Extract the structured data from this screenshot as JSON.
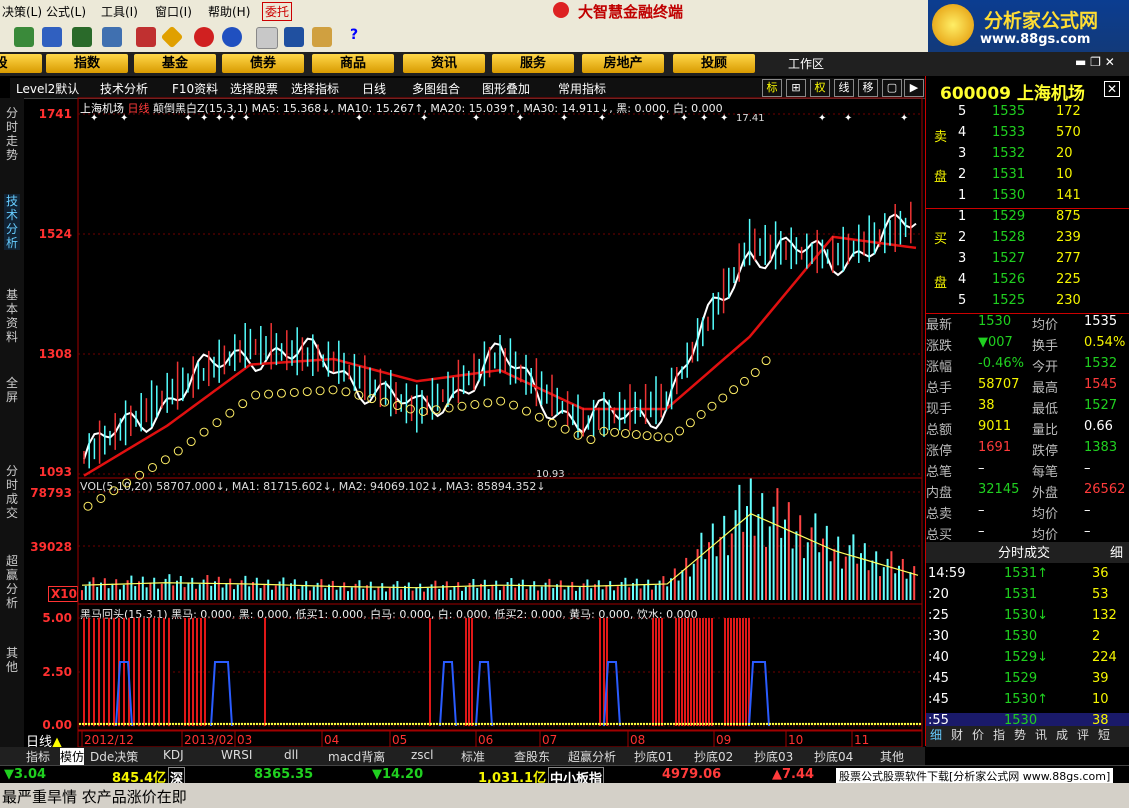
{
  "menu": {
    "items": [
      "决策(L)",
      "公式(L)",
      "工具(I)",
      "窗口(I)",
      "帮助(H)",
      "委托"
    ],
    "title": "大智慧金融终端"
  },
  "brand": {
    "name": "分析家公式网",
    "url": "www.88gs.com"
  },
  "market_buttons": [
    "股",
    "指数",
    "基金",
    "债券",
    "商品",
    "资讯",
    "服务",
    "房地产",
    "投顾"
  ],
  "workzone": "工作区",
  "chart_toolbar": {
    "items": [
      "Level2默认",
      "技术分析",
      "F10资料",
      "选择股票",
      "选择指标",
      "日线",
      "多图组合",
      "图形叠加",
      "常用指标"
    ],
    "right_buttons": [
      "标",
      "权",
      "线",
      "移"
    ]
  },
  "left_tabs": [
    "分时走势",
    "技术分析",
    "基本资料",
    "全屏",
    "分时成交",
    "超赢分析",
    "其他"
  ],
  "main_chart": {
    "stock_name": "上海机场",
    "period": "日线",
    "indicator_line": "颠倒黑白Z(15,3,1)  MA5: 15.368↓, MA10: 15.267↑, MA20: 15.039↑, MA30: 14.911↓, 黑: 0.000, 白: 0.000",
    "price_labels": [
      "1741",
      "1524",
      "1308",
      "1093"
    ],
    "high_note": "17.41",
    "low_note": "10.93"
  },
  "volume_chart": {
    "header": "VOL(5,10,20) 58707.000↓, MA1: 81715.602↓, MA2: 94069.102↓, MA3: 85894.352↓",
    "labels": [
      "78793",
      "39028",
      "X10"
    ]
  },
  "sub_chart": {
    "header": "黑马回头(15,3,1) 黑马: 0.000, 黑: 0.000, 低买1: 0.000, 白马: 0.000, 白: 0.000, 低买2: 0.000, 黄马: 0.000, 饮水: 0.000",
    "labels": [
      "5.00",
      "2.50",
      "0.00"
    ]
  },
  "x_axis": [
    "2012/12",
    "2013/02",
    "03",
    "04",
    "05",
    "06",
    "07",
    "08",
    "09",
    "10",
    "11"
  ],
  "timeframe_label": "日线",
  "chart_data": [
    {
      "type": "line",
      "title": "上海机场 日线",
      "x": [
        "2012/12",
        "2013/02",
        "03",
        "04",
        "05",
        "06",
        "07",
        "08",
        "09",
        "10",
        "11"
      ],
      "series": [
        {
          "name": "MA5",
          "values": [
            11.2,
            12.3,
            13.2,
            12.9,
            12.0,
            13.0,
            11.8,
            12.2,
            15.0,
            14.8,
            15.4
          ]
        },
        {
          "name": "MA20",
          "values": [
            10.9,
            11.8,
            12.9,
            13.0,
            12.6,
            12.8,
            12.1,
            12.1,
            13.4,
            15.2,
            15.0
          ]
        }
      ],
      "ylim": [
        10.93,
        17.41
      ]
    },
    {
      "type": "bar",
      "title": "VOL(5,10,20)",
      "categories": [
        "2012/12",
        "2013/02",
        "03",
        "04",
        "05",
        "06",
        "07",
        "08",
        "09",
        "10",
        "11"
      ],
      "values": [
        12000,
        14000,
        13000,
        11000,
        10000,
        12000,
        11000,
        13000,
        70000,
        40000,
        20000
      ],
      "ylim": [
        0,
        78793
      ]
    }
  ],
  "quote": {
    "code": "600009",
    "name": "上海机场",
    "sell_label": [
      "卖",
      "盘"
    ],
    "buy_label": [
      "买",
      "盘"
    ],
    "asks": [
      {
        "lvl": "5",
        "price": "1535",
        "vol": "172"
      },
      {
        "lvl": "4",
        "price": "1533",
        "vol": "570"
      },
      {
        "lvl": "3",
        "price": "1532",
        "vol": "20"
      },
      {
        "lvl": "2",
        "price": "1531",
        "vol": "10"
      },
      {
        "lvl": "1",
        "price": "1530",
        "vol": "141"
      }
    ],
    "bids": [
      {
        "lvl": "1",
        "price": "1529",
        "vol": "875"
      },
      {
        "lvl": "2",
        "price": "1528",
        "vol": "239"
      },
      {
        "lvl": "3",
        "price": "1527",
        "vol": "277"
      },
      {
        "lvl": "4",
        "price": "1526",
        "vol": "225"
      },
      {
        "lvl": "5",
        "price": "1525",
        "vol": "230"
      }
    ],
    "stats": [
      {
        "l1": "最新",
        "v1": "1530",
        "l2": "均价",
        "v2": "1535"
      },
      {
        "l1": "涨跌",
        "v1": "▼007",
        "l2": "换手",
        "v2": "0.54%"
      },
      {
        "l1": "涨幅",
        "v1": "-0.46%",
        "l2": "今开",
        "v2": "1532"
      },
      {
        "l1": "总手",
        "v1": "58707",
        "l2": "最高",
        "v2": "1545"
      },
      {
        "l1": "现手",
        "v1": "38",
        "l2": "最低",
        "v2": "1527"
      },
      {
        "l1": "总额",
        "v1": "9011",
        "l2": "量比",
        "v2": "0.66"
      },
      {
        "l1": "涨停",
        "v1": "1691",
        "l2": "跌停",
        "v2": "1383"
      },
      {
        "l1": "总笔",
        "v1": "–",
        "l2": "每笔",
        "v2": "–"
      },
      {
        "l1": "内盘",
        "v1": "32145",
        "l2": "外盘",
        "v2": "26562"
      },
      {
        "l1": "总卖",
        "v1": "–",
        "l2": "均价",
        "v2": "–"
      },
      {
        "l1": "总买",
        "v1": "–",
        "l2": "均价",
        "v2": "–"
      }
    ],
    "ticks_header": "分时成交",
    "ticks_tab": "细",
    "ticks": [
      {
        "t": "14:59",
        "p": "1531↑",
        "v": "36"
      },
      {
        "t": ":20",
        "p": "1531",
        "v": "53"
      },
      {
        "t": ":25",
        "p": "1530↓",
        "v": "132"
      },
      {
        "t": ":30",
        "p": "1530",
        "v": "2"
      },
      {
        "t": ":40",
        "p": "1529↓",
        "v": "224"
      },
      {
        "t": ":45",
        "p": "1529",
        "v": "39"
      },
      {
        "t": ":45",
        "p": "1530↑",
        "v": "10"
      },
      {
        "t": ":55",
        "p": "1530",
        "v": "38"
      }
    ],
    "bottom_tabs": [
      "细",
      "财",
      "价",
      "指",
      "势",
      "讯",
      "成",
      "评",
      "短"
    ]
  },
  "bottom_tabs": [
    "指标",
    "模仿",
    "Dde决策",
    "KDJ",
    "WRSI",
    "dll",
    "macd背离",
    "zscl",
    "标准",
    "查股东",
    "超赢分析",
    "抄底01",
    "抄底02",
    "抄底03",
    "抄底04",
    "其他"
  ],
  "status": {
    "s1": "▼3.04",
    "s2": "845.4亿",
    "s3": "深",
    "s4": "8365.35",
    "s5": "▼14.20",
    "s6": "1,031.1亿",
    "s7": "中小板指",
    "s8": "4979.06",
    "s9": "▲7.44"
  },
  "news": {
    "text": "最严重旱情 农产品涨价在即",
    "ad": "股票公式股票软件下载[分析家公式网 www.88gs.com]"
  }
}
